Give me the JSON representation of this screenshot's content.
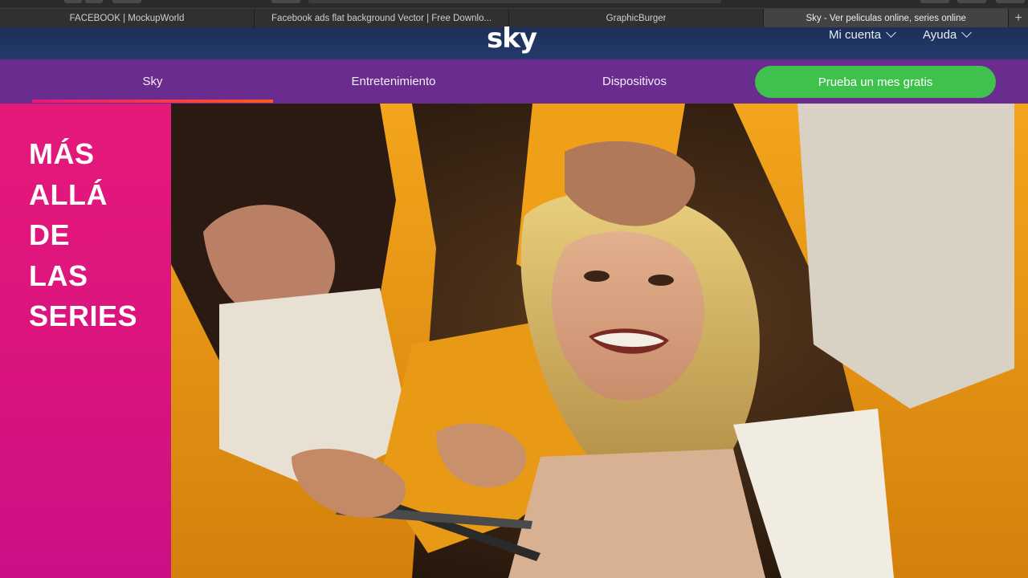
{
  "browser": {
    "tabs": [
      {
        "label": "FACEBOOK | MockupWorld",
        "active": false
      },
      {
        "label": "Facebook ads flat background Vector | Free Downlo...",
        "active": false
      },
      {
        "label": "GraphicBurger",
        "active": false
      },
      {
        "label": "Sky - Ver peliculas online, series online",
        "active": true
      }
    ],
    "new_tab_label": "+"
  },
  "header": {
    "logo": "sky",
    "account_label": "Mi cuenta",
    "help_label": "Ayuda"
  },
  "nav": {
    "items": [
      {
        "label": "Sky",
        "active": true
      },
      {
        "label": "Entretenimiento",
        "active": false
      },
      {
        "label": "Dispositivos",
        "active": false
      }
    ],
    "cta_label": "Prueba un mes gratis"
  },
  "hero": {
    "tagline_lines": [
      "MÁS",
      "ALLÁ",
      "DE",
      "LAS",
      "SERIES"
    ],
    "image_alt_icon": "photo-icon"
  },
  "colors": {
    "header_bg": "#1d2f59",
    "nav_bg": "#6a2c8e",
    "cta_bg": "#3ec24d",
    "hero_side_bg": "#e5197a",
    "active_underline": "#e8177d"
  }
}
